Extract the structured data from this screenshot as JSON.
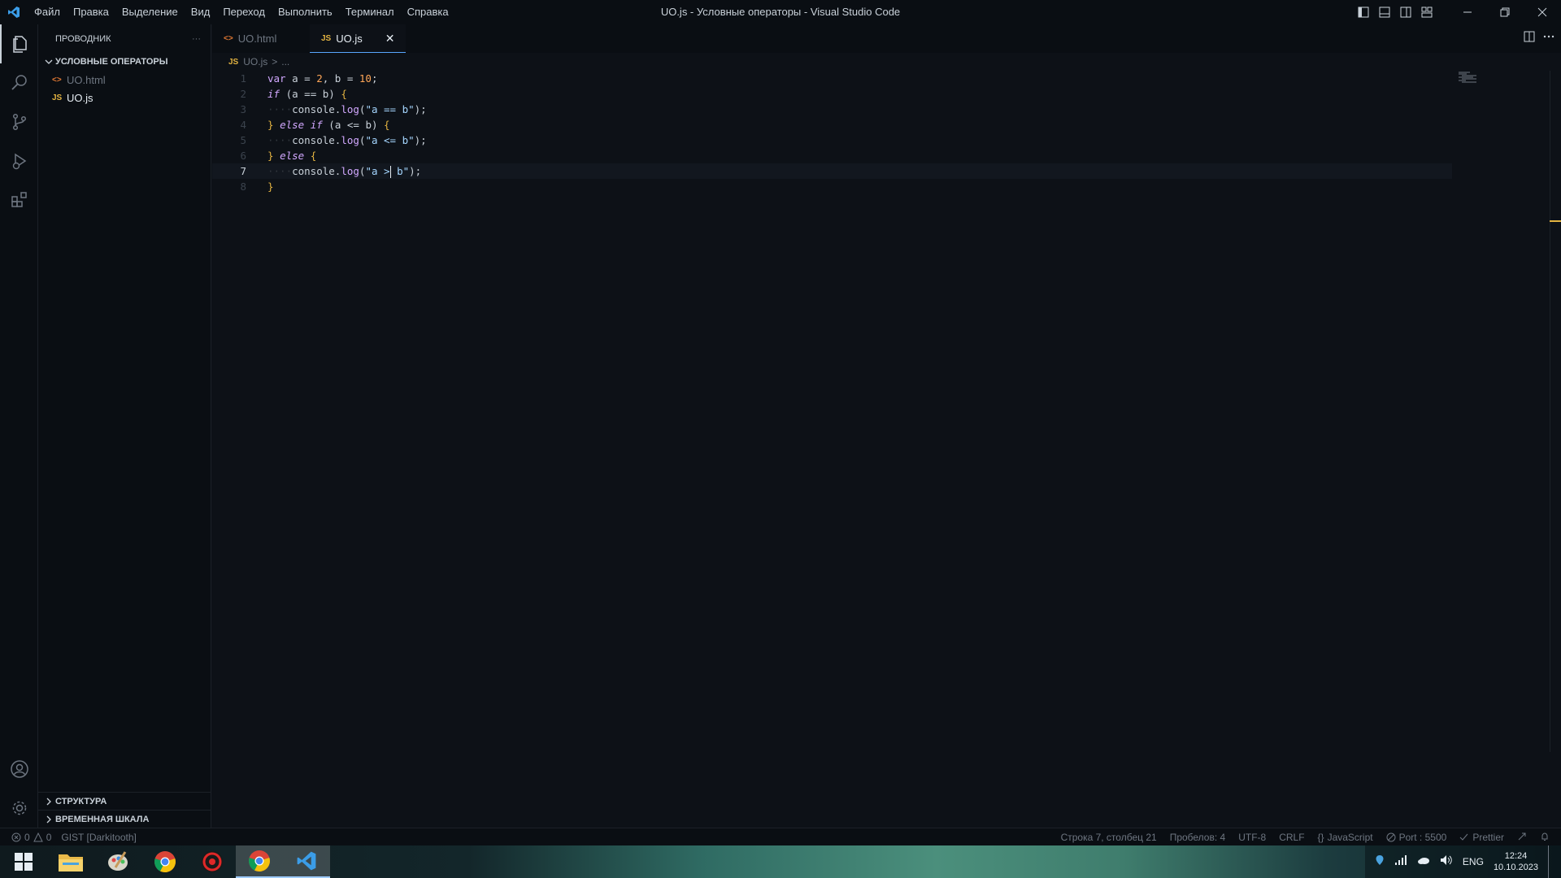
{
  "titlebar": {
    "menu": [
      "Файл",
      "Правка",
      "Выделение",
      "Вид",
      "Переход",
      "Выполнить",
      "Терминал",
      "Справка"
    ],
    "window_title": "UO.js - Условные операторы - Visual Studio Code"
  },
  "activitybar": {
    "icons": [
      "explorer-icon",
      "search-icon",
      "source-control-icon",
      "run-debug-icon",
      "extensions-icon",
      "account-icon",
      "settings-gear-icon"
    ]
  },
  "sidebar": {
    "title": "ПРОВОДНИК",
    "more": "···",
    "folder": "УСЛОВНЫЕ ОПЕРАТОРЫ",
    "files": [
      {
        "icon": "<>",
        "name": "UO.html"
      },
      {
        "icon": "JS",
        "name": "UO.js"
      }
    ],
    "outline": "СТРУКТУРА",
    "timeline": "ВРЕМЕННАЯ ШКАЛА"
  },
  "tabs": [
    {
      "icon": "<>",
      "label": "UO.html"
    },
    {
      "icon": "JS",
      "label": "UO.js",
      "close": "✕"
    }
  ],
  "breadcrumb": {
    "icon": "JS",
    "file": "UO.js",
    "sep": ">",
    "rest": "..."
  },
  "code": {
    "line_numbers": [
      "1",
      "2",
      "3",
      "4",
      "5",
      "6",
      "7",
      "8"
    ],
    "cursor_line": 7
  },
  "statusbar": {
    "errors": "0",
    "warnings": "0",
    "gist": "GIST [Darkitooth]",
    "position": "Строка 7, столбец 21",
    "spaces": "Пробелов: 4",
    "encoding": "UTF-8",
    "eol": "CRLF",
    "language": "JavaScript",
    "port": "Port : 5500",
    "prettier": "Prettier"
  },
  "taskbar": {
    "apps": [
      "windows-start-icon",
      "file-explorer-icon",
      "paint-icon",
      "chrome-icon",
      "red-app-icon",
      "chrome-canary-icon",
      "vscode-icon"
    ],
    "lang": "ENG",
    "time": "12:24",
    "date": "10.10.2023"
  },
  "colors": {
    "background": "#0d1117",
    "keyword": "#d2a8ff",
    "number": "#ffa657",
    "string": "#a5d6ff",
    "bracket": "#e3b341"
  }
}
